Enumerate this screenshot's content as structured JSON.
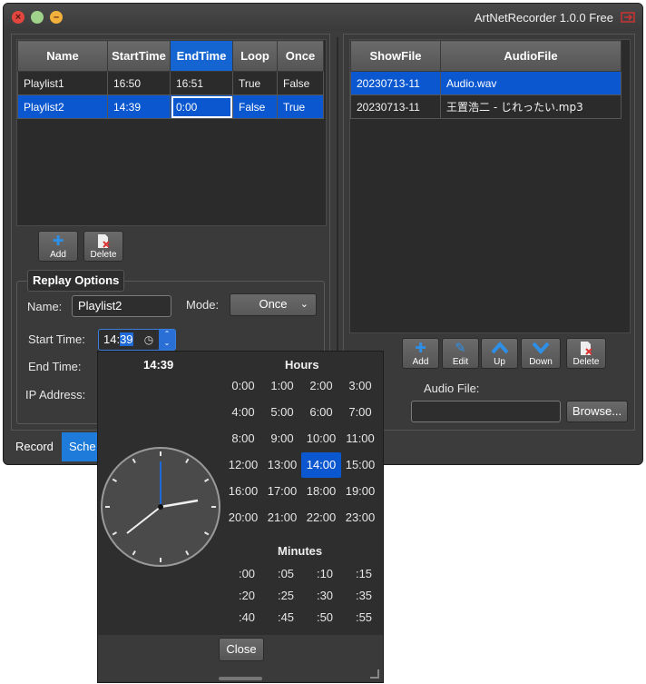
{
  "window": {
    "title": "ArtNetRecorder 1.0.0 Free"
  },
  "playlist_table": {
    "columns": [
      "Name",
      "StartTime",
      "EndTime",
      "Loop",
      "Once"
    ],
    "rows": [
      [
        "Playlist1",
        "16:50",
        "16:51",
        "True",
        "False"
      ],
      [
        "Playlist2",
        "14:39",
        "0:00",
        "False",
        "True"
      ]
    ]
  },
  "playlist_buttons": {
    "add": "Add",
    "delete": "Delete"
  },
  "replay_options": {
    "title": "Replay Options",
    "name_label": "Name:",
    "name_value": "Playlist2",
    "mode_label": "Mode:",
    "mode_value": "Once",
    "start_label": "Start Time:",
    "start_value_hours": "14:",
    "start_value_minutes": "39",
    "end_label": "End Time:",
    "ip_label": "IP Address:"
  },
  "tabs": [
    "Record",
    "Sche"
  ],
  "show_table": {
    "columns": [
      "ShowFile",
      "AudioFile"
    ],
    "rows": [
      [
        "20230713-11",
        "Audio.wav"
      ],
      [
        "20230713-11",
        "王置浩二 - じれったい.mp3"
      ]
    ]
  },
  "show_buttons": {
    "add": "Add",
    "edit": "Edit",
    "up": "Up",
    "down": "Down",
    "delete": "Delete"
  },
  "audio": {
    "label": "Audio File:",
    "value": "",
    "browse": "Browse..."
  },
  "time_picker": {
    "current": "14:39",
    "hours_title": "Hours",
    "hours": [
      "0:00",
      "1:00",
      "2:00",
      "3:00",
      "4:00",
      "5:00",
      "6:00",
      "7:00",
      "8:00",
      "9:00",
      "10:00",
      "11:00",
      "12:00",
      "13:00",
      "14:00",
      "15:00",
      "16:00",
      "17:00",
      "18:00",
      "19:00",
      "20:00",
      "21:00",
      "22:00",
      "23:00"
    ],
    "selected_hour": "14:00",
    "minutes_title": "Minutes",
    "minutes": [
      ":00",
      ":05",
      ":10",
      ":15",
      ":20",
      ":25",
      ":30",
      ":35",
      ":40",
      ":45",
      ":50",
      ":55"
    ],
    "close": "Close"
  },
  "colors": {
    "accent": "#0a57d0",
    "background": "#3c3c3c",
    "header": "#5e5e5e"
  }
}
